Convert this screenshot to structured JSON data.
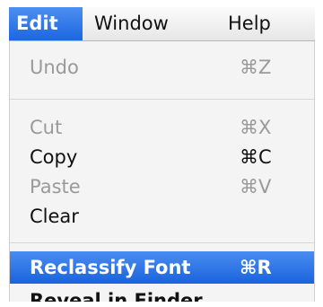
{
  "menubar": {
    "items": [
      {
        "label": "Edit",
        "active": true
      },
      {
        "label": "Window",
        "active": false
      },
      {
        "label": "Help",
        "active": false
      }
    ]
  },
  "edit_menu": {
    "items": [
      {
        "label": "Undo",
        "shortcut": "⌘Z",
        "enabled": false
      },
      {
        "label": "Cut",
        "shortcut": "⌘X",
        "enabled": false
      },
      {
        "label": "Copy",
        "shortcut": "⌘C",
        "enabled": true
      },
      {
        "label": "Paste",
        "shortcut": "⌘V",
        "enabled": false
      },
      {
        "label": "Clear",
        "shortcut": "",
        "enabled": true
      },
      {
        "label": "Reclassify Font",
        "shortcut": "⌘R",
        "enabled": true,
        "highlighted": true
      },
      {
        "label": "Reveal in Finder",
        "shortcut": "",
        "enabled": true
      }
    ]
  },
  "colors": {
    "highlight": "#1c66e0",
    "disabled_text": "#9a9a9a",
    "menu_bg": "#f4f4f4"
  }
}
